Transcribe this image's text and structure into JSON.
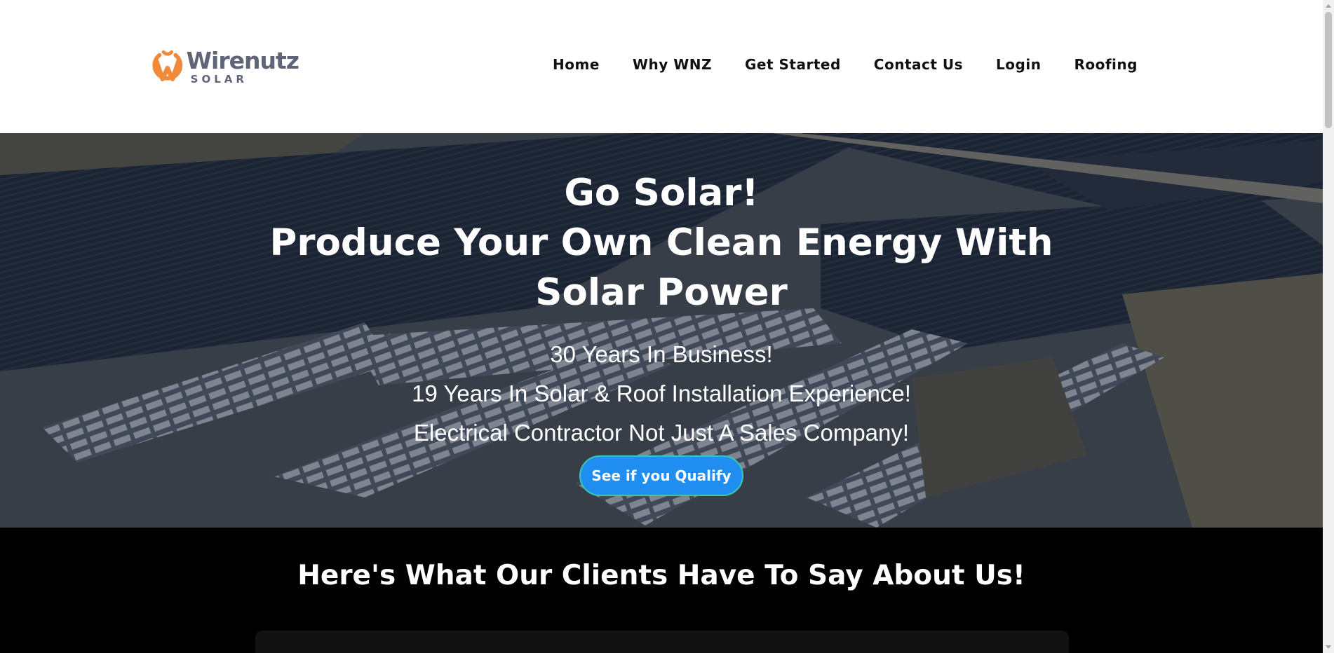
{
  "header": {
    "logo": {
      "name": "Wirenutz",
      "sub": "SOLAR",
      "brand_orange": "#f08a3a",
      "brand_gray": "#5f6577"
    },
    "nav": [
      {
        "label": "Home"
      },
      {
        "label": "Why WNZ"
      },
      {
        "label": "Get Started"
      },
      {
        "label": "Contact Us"
      },
      {
        "label": "Login"
      },
      {
        "label": "Roofing"
      }
    ]
  },
  "hero": {
    "background": "aerial-solar-farm-image",
    "title_lines": [
      "Go Solar!",
      "Produce Your Own Clean Energy With",
      "Solar Power"
    ],
    "lines": [
      "30 Years In Business!",
      "19 Years In Solar & Roof Installation Experience!",
      "Electrical Contractor Not Just A Sales Company!"
    ],
    "cta_label": "See if you Qualify",
    "cta_color": "#1f8ef0"
  },
  "testimonials": {
    "title": "Here's What Our Clients Have To Say About Us!"
  }
}
